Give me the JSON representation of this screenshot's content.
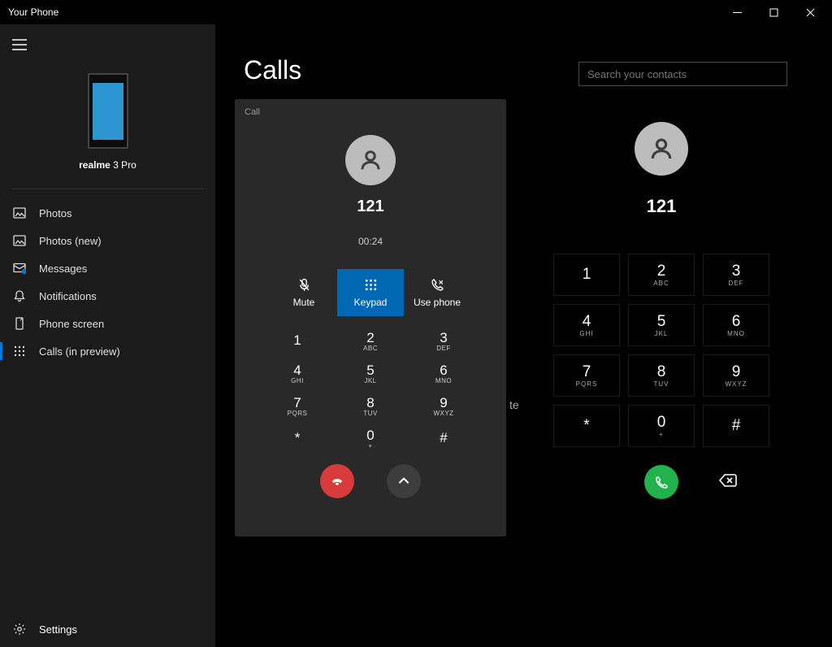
{
  "titlebar": {
    "title": "Your Phone"
  },
  "device": {
    "name_bold": "realme",
    "name_rest": " 3 Pro"
  },
  "nav": {
    "items": [
      {
        "label": "Photos"
      },
      {
        "label": "Photos (new)"
      },
      {
        "label": "Messages"
      },
      {
        "label": "Notifications"
      },
      {
        "label": "Phone screen"
      },
      {
        "label": "Calls (in preview)"
      }
    ],
    "settings": "Settings"
  },
  "main": {
    "title": "Calls",
    "search_placeholder": "Search your contacts",
    "peek": "te"
  },
  "call": {
    "label": "Call",
    "number": "121",
    "timer": "00:24",
    "actions": {
      "mute": "Mute",
      "keypad": "Keypad",
      "usephone": "Use phone"
    }
  },
  "keypad": [
    {
      "d": "1",
      "l": ""
    },
    {
      "d": "2",
      "l": "ABC"
    },
    {
      "d": "3",
      "l": "DEF"
    },
    {
      "d": "4",
      "l": "GHI"
    },
    {
      "d": "5",
      "l": "JKL"
    },
    {
      "d": "6",
      "l": "MNO"
    },
    {
      "d": "7",
      "l": "PQRS"
    },
    {
      "d": "8",
      "l": "TUV"
    },
    {
      "d": "9",
      "l": "WXYZ"
    },
    {
      "d": "*",
      "l": ""
    },
    {
      "d": "0",
      "l": "+"
    },
    {
      "d": "#",
      "l": ""
    }
  ],
  "dialer": {
    "number": "121"
  }
}
